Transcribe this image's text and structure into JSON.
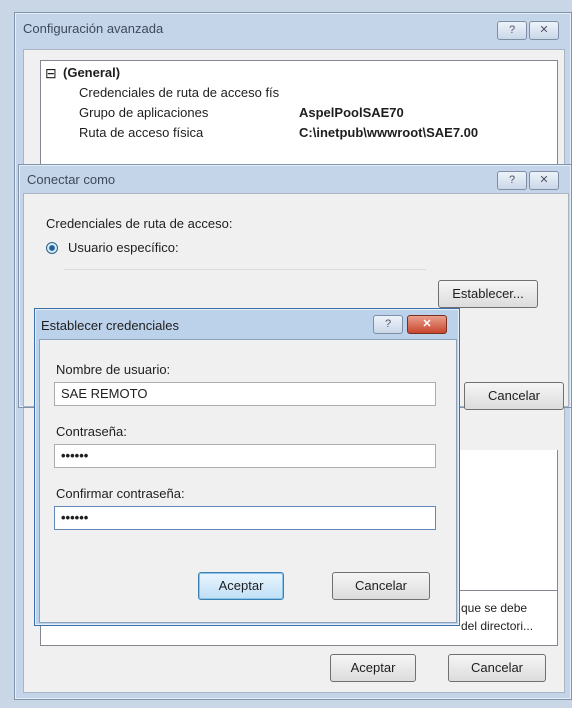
{
  "advanced": {
    "title": "Configuración avanzada",
    "help_icon": "?",
    "close_icon": "✕",
    "section": "(General)",
    "expander": "⊟",
    "rows": [
      {
        "name": "Credenciales de ruta de acceso fís",
        "value": ""
      },
      {
        "name": "Grupo de aplicaciones",
        "value": "AspelPoolSAE70"
      },
      {
        "name": "Ruta de acceso física",
        "value": "C:\\inetpub\\wwwroot\\SAE7.00"
      }
    ],
    "description_partial_1": "que se debe",
    "description_partial_2": "del directori...",
    "ok_label": "Aceptar",
    "cancel_label": "Cancelar"
  },
  "connect": {
    "title": "Conectar como",
    "help_icon": "?",
    "close_icon": "✕",
    "credentials_label": "Credenciales de ruta de acceso:",
    "specific_user_label": "Usuario específico:",
    "set_button": "Establecer...",
    "cancel_label": "Cancelar"
  },
  "setcred": {
    "title": "Establecer credenciales",
    "help_icon": "?",
    "close_icon": "✕",
    "username_label": "Nombre de usuario:",
    "username_value": "SAE REMOTO",
    "password_label": "Contraseña:",
    "password_value": "••••••",
    "confirm_label": "Confirmar contraseña:",
    "confirm_value": "••••••",
    "ok_label": "Aceptar",
    "cancel_label": "Cancelar"
  }
}
